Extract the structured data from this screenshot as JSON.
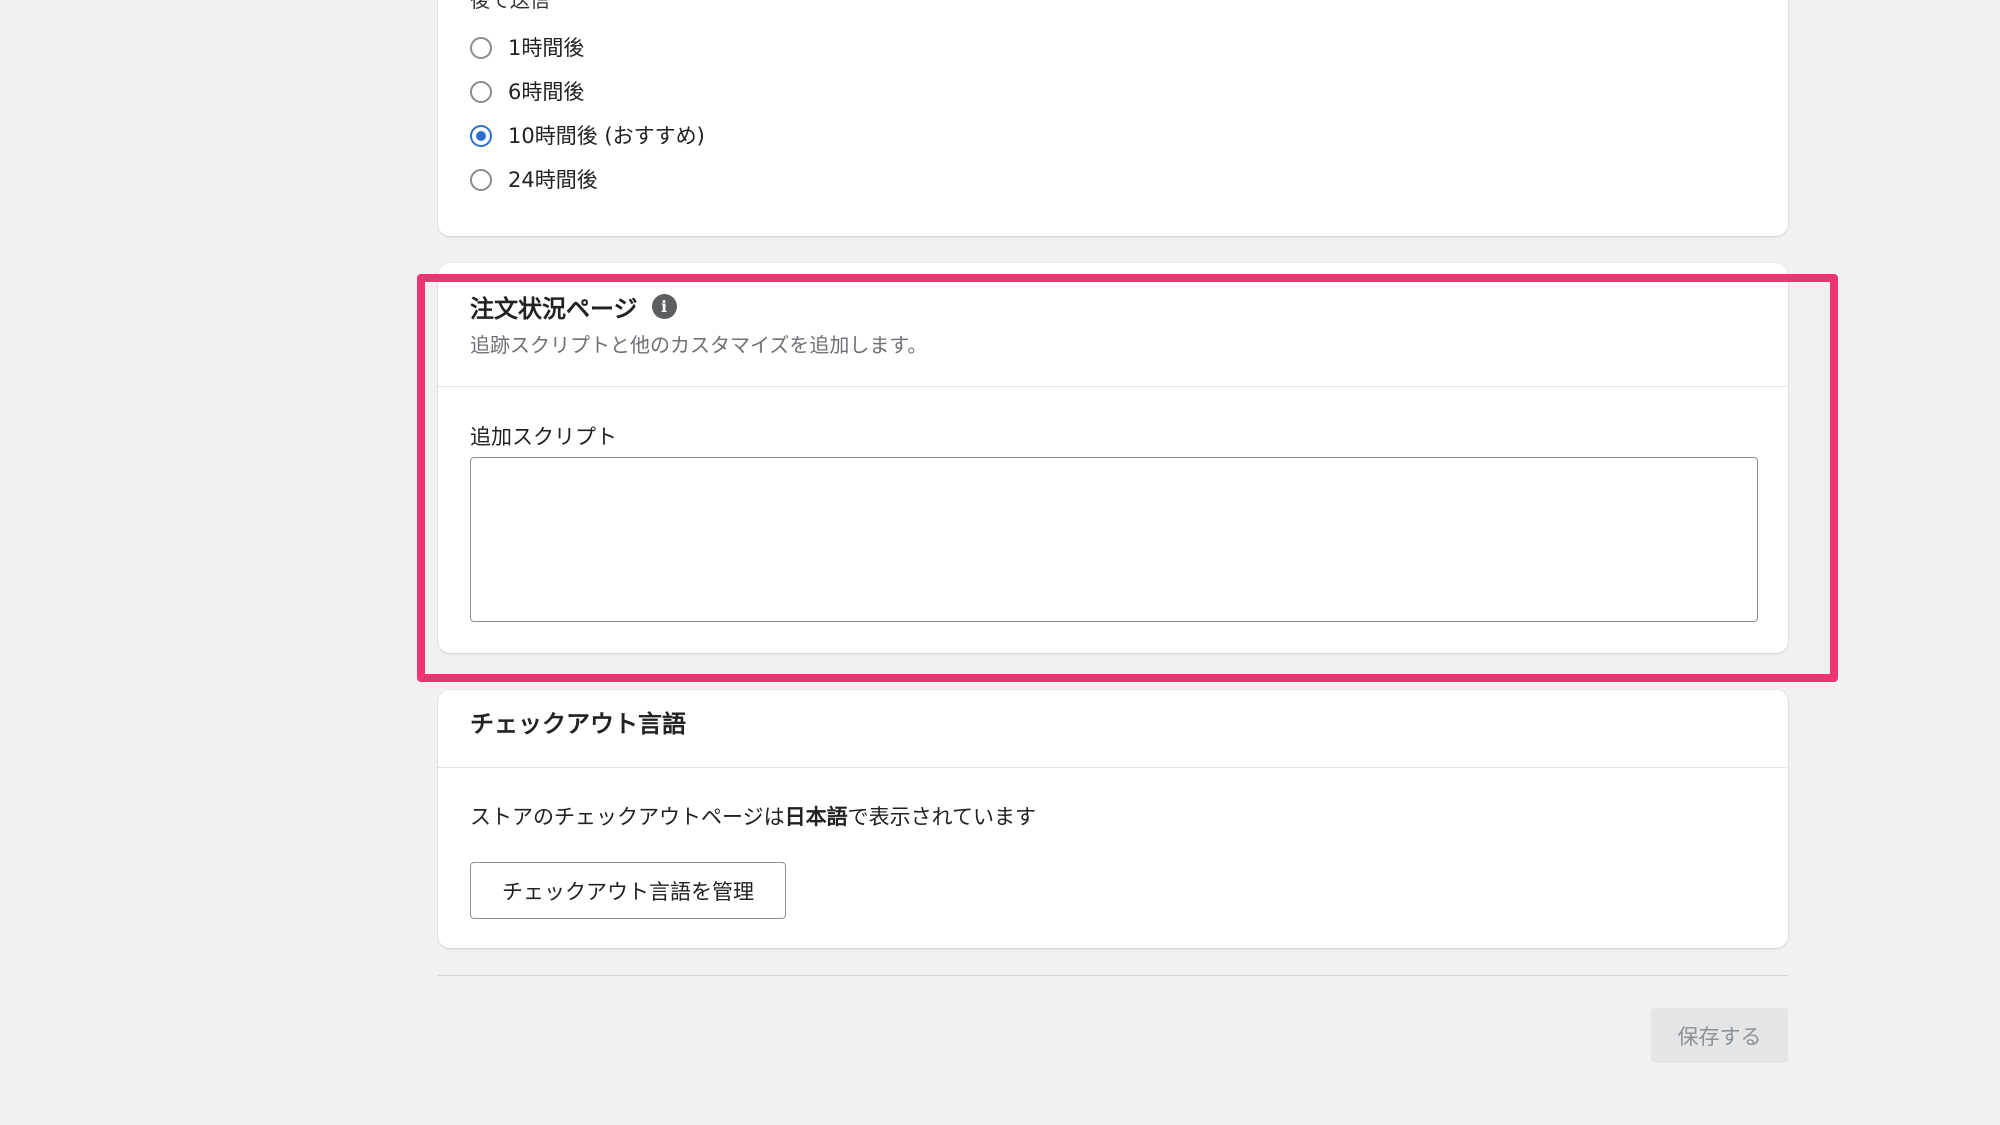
{
  "send_later": {
    "heading": "後で送信",
    "options": [
      {
        "label": "1時間後",
        "checked": false
      },
      {
        "label": "6時間後",
        "checked": false
      },
      {
        "label": "10時間後 (おすすめ)",
        "checked": true
      },
      {
        "label": "24時間後",
        "checked": false
      }
    ]
  },
  "order_status": {
    "title": "注文状況ページ",
    "info_icon": "info-icon",
    "description": "追跡スクリプトと他のカスタマイズを追加します。",
    "script_label": "追加スクリプト",
    "script_value": ""
  },
  "checkout_language": {
    "title": "チェックアウト言語",
    "text_before": "ストアのチェックアウトページは",
    "language": "日本語",
    "text_after": "で表示されています",
    "manage_button": "チェックアウト言語を管理"
  },
  "footer": {
    "save_button": "保存する"
  },
  "colors": {
    "highlight": "#ef3473",
    "radio_checked": "#2c6ecb",
    "background": "#f0f1f3"
  }
}
